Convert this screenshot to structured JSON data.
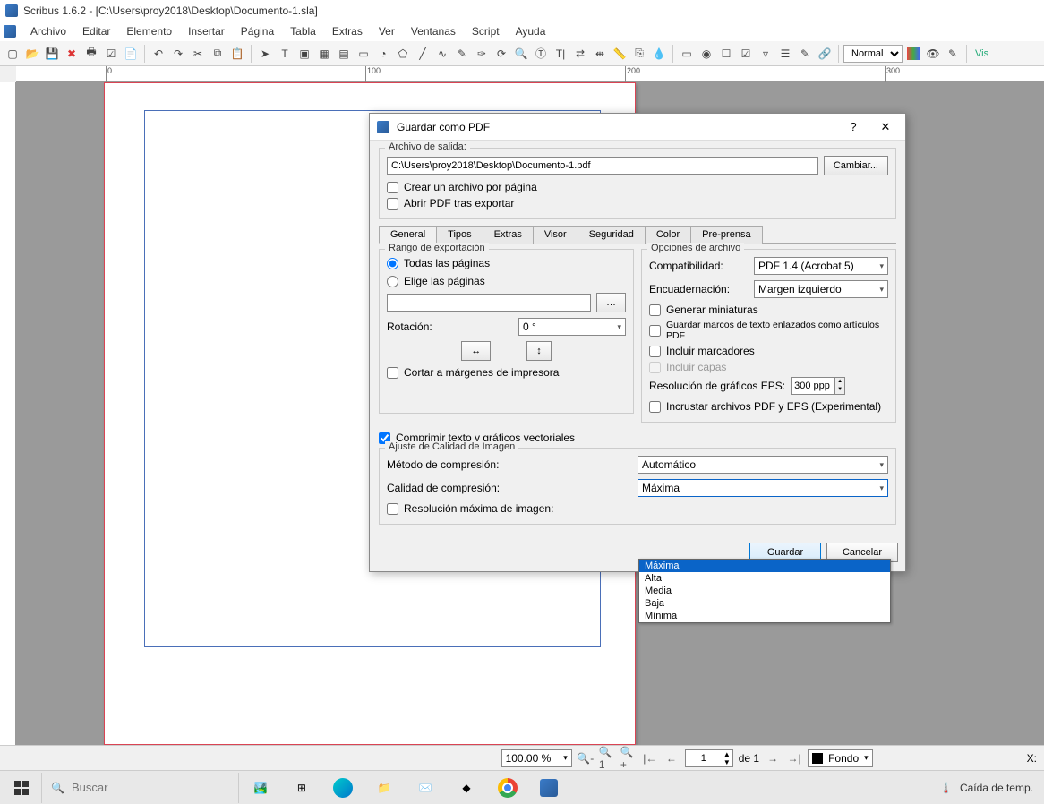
{
  "window": {
    "title": "Scribus 1.6.2 - [C:\\Users\\proy2018\\Desktop\\Documento-1.sla]"
  },
  "menu": [
    "Archivo",
    "Editar",
    "Elemento",
    "Insertar",
    "Página",
    "Tabla",
    "Extras",
    "Ver",
    "Ventanas",
    "Script",
    "Ayuda"
  ],
  "toolbar": {
    "mode": "Normal",
    "vis_label": "Vis"
  },
  "ruler": {
    "h": [
      "0",
      "100",
      "200",
      "300"
    ]
  },
  "dialog": {
    "title": "Guardar como PDF",
    "archivo_title": "Archivo de salida:",
    "path": "C:\\Users\\proy2018\\Desktop\\Documento-1.pdf",
    "change": "Cambiar...",
    "chk_perpage": "Crear un archivo por página",
    "chk_openafter": "Abrir PDF tras exportar",
    "tabs": [
      "General",
      "Tipos",
      "Extras",
      "Visor",
      "Seguridad",
      "Color",
      "Pre-prensa"
    ],
    "rango": {
      "title": "Rango de exportación",
      "all": "Todas las páginas",
      "choose": "Elige las páginas",
      "rot": "Rotación:",
      "rot_val": "0 °",
      "clip": "Cortar a márgenes de impresora"
    },
    "opts": {
      "title": "Opciones de archivo",
      "compat": "Compatibilidad:",
      "compat_val": "PDF 1.4 (Acrobat 5)",
      "binding": "Encuadernación:",
      "binding_val": "Margen izquierdo",
      "thumbs": "Generar miniaturas",
      "articles": "Guardar marcos de texto enlazados como artículos PDF",
      "bookmarks": "Incluir marcadores",
      "layers": "Incluir capas",
      "eps": "Resolución de gráficos EPS:",
      "eps_val": "300 ppp",
      "embed": "Incrustar archivos PDF y EPS (Experimental)"
    },
    "compress_vec": "Comprimir texto y gráficos vectoriales",
    "imgq": {
      "title": "Ajuste de Calidad de Imagen",
      "method": "Método de compresión:",
      "method_val": "Automático",
      "quality": "Calidad de compresión:",
      "quality_val": "Máxima",
      "maxres": "Resolución máxima de imagen:",
      "options": [
        "Máxima",
        "Alta",
        "Media",
        "Baja",
        "Mínima"
      ]
    },
    "save": "Guardar",
    "cancel": "Cancelar"
  },
  "statusbar": {
    "zoom": "100.00 %",
    "page": "1",
    "of": "de 1",
    "layer": "Fondo",
    "x": "X:"
  },
  "taskbar": {
    "search": "Buscar",
    "weather": "Caída de temp."
  }
}
